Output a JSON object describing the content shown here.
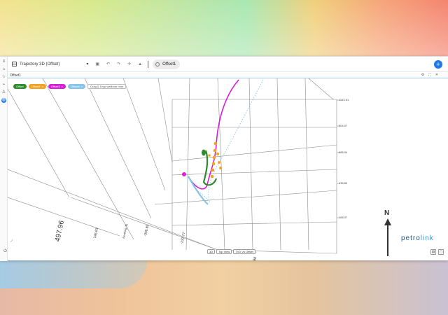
{
  "window": {
    "title": "Trajectory 3D (Offset)",
    "tab_label": "Offset1",
    "panel_label": "Offset1"
  },
  "toolbar": {
    "dropdown_caret": "▾",
    "save_icon": "💾",
    "undo_icon": "↶",
    "redo_icon": "↷",
    "pin_icon": "⚲",
    "bell_icon": "♦",
    "add_label": "+"
  },
  "panel_tools": [
    "⚙",
    "⛶",
    "✕"
  ],
  "chips": [
    {
      "label": "Offset",
      "color": "#2e8b2e"
    },
    {
      "label": "Offset2",
      "color": "#f2a21c"
    },
    {
      "label": "Offset3",
      "color": "#d81fd8"
    },
    {
      "label": "Offset4",
      "color": "#86c5e8"
    }
  ],
  "drop_box": "Drag & Drop wellbore here",
  "axis": {
    "z_ticks": [
      "1163.51",
      "904.07",
      "685.94",
      "436.80",
      "188.07"
    ],
    "slant_labels": [
      "497.96",
      "746.93",
      "-306.85",
      "-237.77",
      "88"
    ],
    "small_labels": [
      "Northing (ft)",
      "Easting"
    ]
  },
  "view_buttons": [
    "3D",
    "Top View",
    "TVD Vs Offset"
  ],
  "north_label": "N",
  "logo": {
    "part1": "petro",
    "part2": "link"
  },
  "colors": {
    "accent": "#1e7be6",
    "offset": "#2e8b2e",
    "offset2": "#f2a21c",
    "offset3": "#d81fd8",
    "offset4": "#86c5e8"
  }
}
